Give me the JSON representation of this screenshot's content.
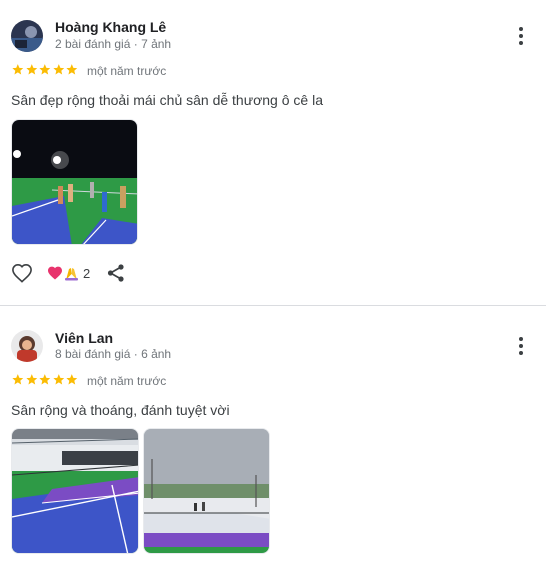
{
  "reviews": [
    {
      "author": "Hoàng Khang Lê",
      "meta": "2 bài đánh giá · 7 ảnh",
      "rating": 5,
      "time": "một năm trước",
      "text": "Sân đẹp rộng thoải mái chủ sân dễ thương ô cê la",
      "photo_count": 1,
      "reaction_count": "2",
      "reaction_icons": [
        "heart-icon",
        "praying-hands-icon"
      ]
    },
    {
      "author": "Viên Lan",
      "meta": "8 bài đánh giá · 6 ảnh",
      "rating": 5,
      "time": "một năm trước",
      "text": "Sân rộng và thoáng, đánh tuyệt vời",
      "photo_count": 2
    }
  ],
  "colors": {
    "star": "#fbbc04",
    "court_blue": "#3d55c8",
    "court_green": "#2e9a46",
    "court_purple": "#7b4cc4",
    "divider": "#dadce0"
  },
  "icons": {
    "more": "more-vert-icon",
    "like": "heart-outline-icon",
    "share": "share-icon"
  }
}
